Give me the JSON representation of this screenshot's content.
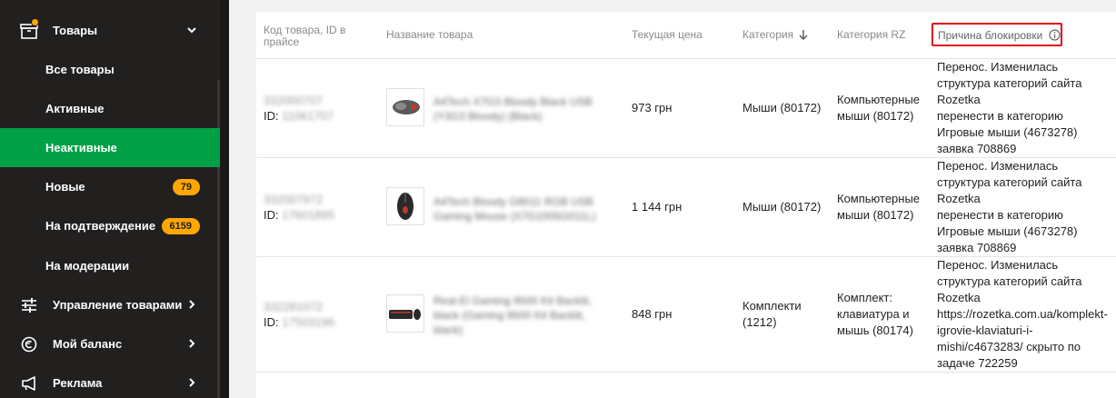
{
  "sidebar": {
    "products": {
      "label": "Товары",
      "icon": "box-icon"
    },
    "sub_items": [
      {
        "label": "Все товары"
      },
      {
        "label": "Активные"
      },
      {
        "label": "Неактивные"
      },
      {
        "label": "Новые",
        "badge": "79"
      },
      {
        "label": "На подтверждение",
        "badge": "6159"
      },
      {
        "label": "На модерации"
      }
    ],
    "manage": {
      "label": "Управление товарами",
      "icon": "sliders-icon"
    },
    "balance": {
      "label": "Мой баланс",
      "icon": "balance-icon"
    },
    "ads": {
      "label": "Реклама",
      "icon": "megaphone-icon"
    },
    "accent_color": "#00a046",
    "badge_color": "#fea700"
  },
  "table": {
    "headers": {
      "code": "Код товара, ID в прайсе",
      "name": "Название товара",
      "price": "Текущая цена",
      "category": "Категория",
      "category_rz": "Категория RZ",
      "reason": "Причина блокировки"
    },
    "rows": [
      {
        "code": "332000707",
        "id_label": "ID:",
        "id_value": "11061707",
        "name": "A4Tech X7G3 Bloody Black USB (Y3G3 Bloody) (Black)",
        "price": "973 грн",
        "category": "Мыши (80172)",
        "category_rz": "Компьютерные мыши (80172)",
        "reason": [
          "Перенос. Изменилась",
          "структура категорий сайта",
          "Rozetka",
          "перенести в категорию",
          "Игровые мыши (4673278)",
          "заявка 708869"
        ]
      },
      {
        "code": "332007972",
        "id_label": "ID:",
        "id_value": "17601895",
        "name": "A4Tech Bloody G8011 RGB USB Gaming Mouse (X7G1005G011L)",
        "price": "1 144 грн",
        "category": "Мыши (80172)",
        "category_rz": "Компьютерные мыши (80172)",
        "reason": [
          "Перенос. Изменилась",
          "структура категорий сайта",
          "Rozetka",
          "перенести в категорию",
          "Игровые мыши (4673278)",
          "заявка 708869"
        ]
      },
      {
        "code": "332281072",
        "id_label": "ID:",
        "id_value": "17503196",
        "name": "Real-El Gaming 9500 Kit Backlit, black (Gaming 9500 Kit Backlit, black)",
        "price": "848 грн",
        "category": "Комплекти (1212)",
        "category_rz": "Комплект: клавиатура и мышь (80174)",
        "reason": [
          "Перенос. Изменилась",
          "структура категорий сайта",
          "Rozetka",
          "https://rozetka.com.ua/komplekt-",
          "igrovie-klaviaturi-i-",
          "mishi/c4673283/ скрыто по",
          "задаче 722259"
        ]
      }
    ]
  }
}
